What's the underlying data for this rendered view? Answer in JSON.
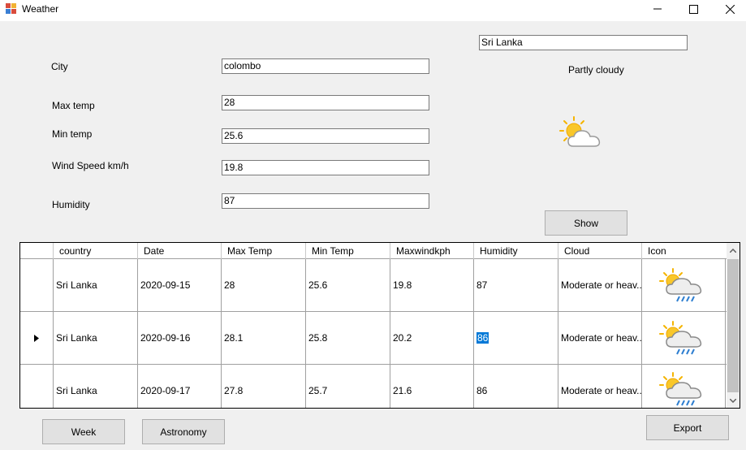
{
  "window": {
    "title": "Weather"
  },
  "form": {
    "city_label": "City",
    "city_value": "colombo",
    "max_temp_label": "Max temp",
    "max_temp_value": "28",
    "min_temp_label": "Min temp",
    "min_temp_value": "25.6",
    "wind_label": "Wind Speed km/h",
    "wind_value": "19.8",
    "humidity_label": "Humidity",
    "humidity_value": "87"
  },
  "current": {
    "country_value": "Sri Lanka",
    "condition": "Partly cloudy",
    "condition_icon": "partly-cloudy-icon"
  },
  "buttons": {
    "show": "Show",
    "week": "Week",
    "astronomy": "Astronomy",
    "export": "Export"
  },
  "grid": {
    "columns": [
      "country",
      "Date",
      "Max Temp",
      "Min Temp",
      "Maxwindkph",
      "Humidity",
      "Cloud",
      "Icon"
    ],
    "rows": [
      {
        "country": "Sri Lanka",
        "date": "2020-09-15",
        "max_temp": "28",
        "min_temp": "25.6",
        "maxwindkph": "19.8",
        "humidity": "87",
        "cloud": "Moderate or heav...",
        "icon": "rain-cloud-sun-icon"
      },
      {
        "country": "Sri Lanka",
        "date": "2020-09-16",
        "max_temp": "28.1",
        "min_temp": "25.8",
        "maxwindkph": "20.2",
        "humidity": "86",
        "cloud": "Moderate or heav...",
        "icon": "rain-cloud-sun-icon"
      },
      {
        "country": "Sri Lanka",
        "date": "2020-09-17",
        "max_temp": "27.8",
        "min_temp": "25.7",
        "maxwindkph": "21.6",
        "humidity": "86",
        "cloud": "Moderate or heav...",
        "icon": "rain-cloud-sun-icon"
      }
    ],
    "selected_row": 1,
    "selected_cell": "humidity"
  },
  "colors": {
    "selection": "#0078d7",
    "window_bg": "#f0f0f0",
    "sun": "#f5c518",
    "rain": "#2f7fd1"
  }
}
